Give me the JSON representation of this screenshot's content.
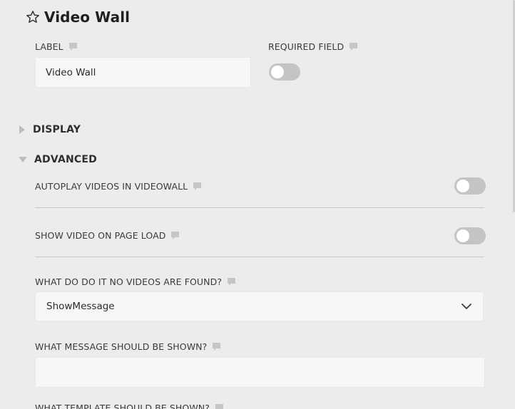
{
  "header": {
    "title": "Video Wall",
    "icon": "star-icon"
  },
  "fields": {
    "label": {
      "label": "LABEL",
      "value": "Video Wall",
      "icon": "comment-icon"
    },
    "required": {
      "label": "REQUIRED FIELD",
      "enabled": false,
      "icon": "comment-icon"
    }
  },
  "sections": {
    "display": {
      "label": "DISPLAY",
      "expanded": false
    },
    "advanced": {
      "label": "ADVANCED",
      "expanded": true,
      "autoplay": {
        "label": "AUTOPLAY VIDEOS IN VIDEOWALL",
        "enabled": false
      },
      "show_on_load": {
        "label": "SHOW VIDEO ON PAGE LOAD",
        "enabled": false
      },
      "no_videos_action": {
        "label": "WHAT DO DO IT NO VIDEOS ARE FOUND?",
        "selected": "ShowMessage"
      },
      "message": {
        "label": "WHAT MESSAGE SHOULD BE SHOWN?",
        "value": ""
      },
      "template": {
        "label": "WHAT TEMPLATE SHOULD BE SHOWN?"
      }
    }
  },
  "colors": {
    "background": "#ececed",
    "input_background": "#f7f7f7",
    "toggle_off": "#c4c4c6",
    "divider": "#c9c9cb"
  }
}
